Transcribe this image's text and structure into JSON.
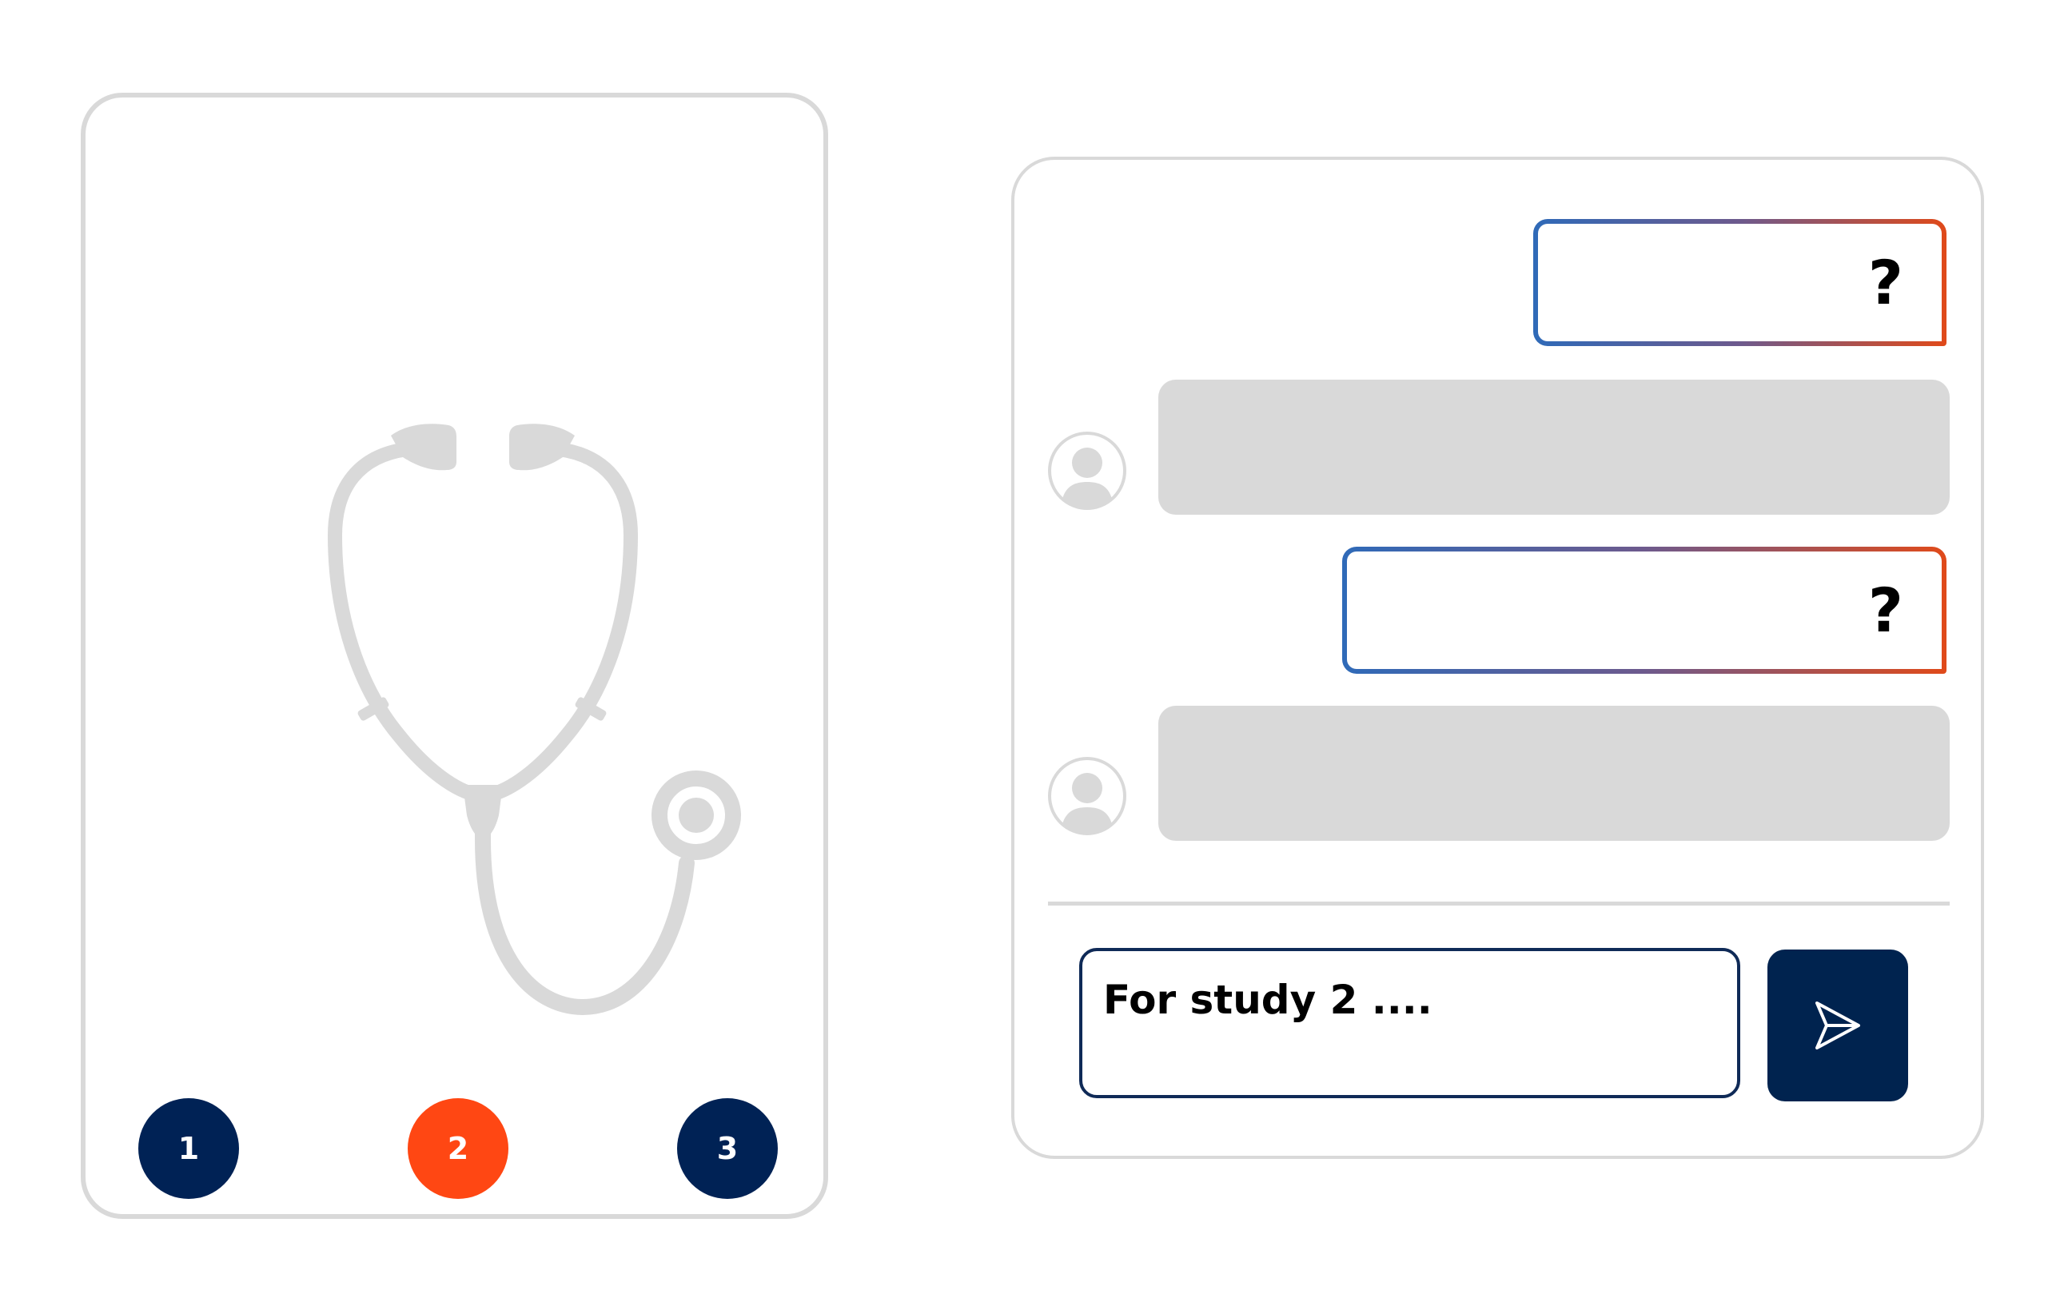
{
  "steps": [
    {
      "label": "1",
      "color": "#002255",
      "active": false
    },
    {
      "label": "2",
      "color": "#ff4713",
      "active": true
    },
    {
      "label": "3",
      "color": "#002255",
      "active": false
    }
  ],
  "chat": {
    "questions": [
      {
        "mark": "?"
      },
      {
        "mark": "?"
      }
    ],
    "input": {
      "value": "For study 2 ...."
    }
  },
  "icons": {
    "illustration": "stethoscope-icon",
    "avatar": "user-avatar-icon",
    "send": "send-icon"
  },
  "colors": {
    "navy": "#002255",
    "accent": "#ff4713",
    "gradient_start": "#2f6ab8",
    "gradient_end": "#e04a1a",
    "placeholder_gray": "#d9d9d9"
  }
}
